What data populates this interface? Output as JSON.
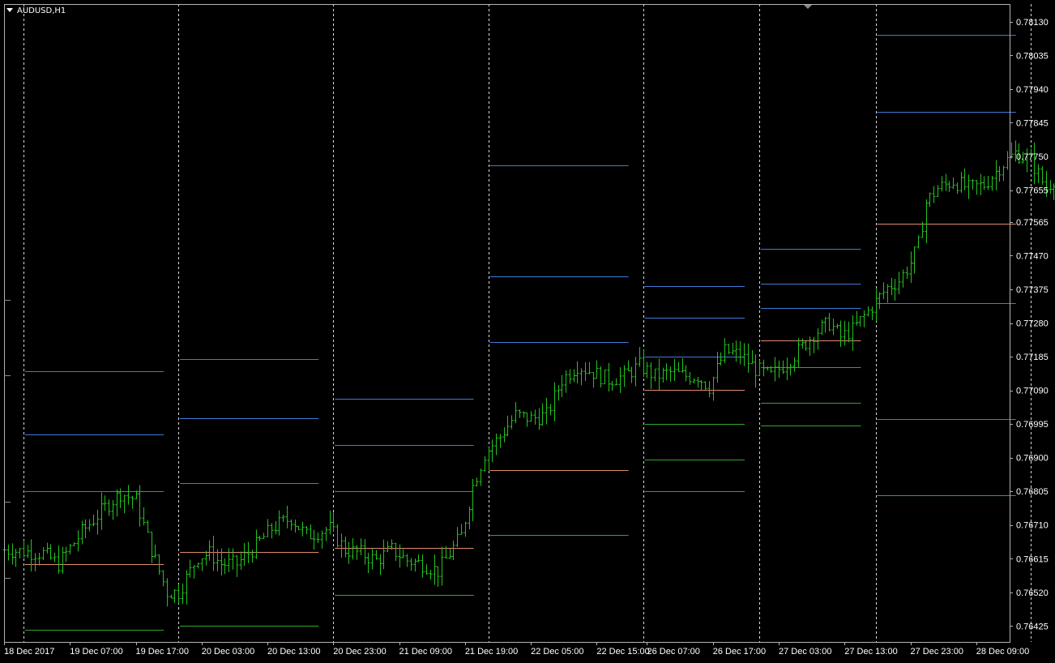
{
  "window": {
    "symbol_title": "AUDUSD,H1"
  },
  "chart_data": {
    "type": "ohlc",
    "symbol": "AUDUSD",
    "timeframe": "H1",
    "ylim": [
      0.7638,
      0.7818
    ],
    "y_ticks": [
      "0.78130",
      "0.78035",
      "0.77940",
      "0.77845",
      "0.77750",
      "0.77655",
      "0.77565",
      "0.77470",
      "0.77375",
      "0.77280",
      "0.77185",
      "0.77090",
      "0.76995",
      "0.76900",
      "0.76805",
      "0.76710",
      "0.76615",
      "0.76520",
      "0.76425"
    ],
    "x_tick_labels": [
      "18 Dec 2017",
      "19 Dec 07:00",
      "19 Dec 17:00",
      "20 Dec 03:00",
      "20 Dec 13:00",
      "20 Dec 23:00",
      "21 Dec 09:00",
      "21 Dec 19:00",
      "22 Dec 05:00",
      "22 Dec 15:00",
      "26 Dec 07:00",
      "26 Dec 17:00",
      "27 Dec 03:00",
      "27 Dec 13:00",
      "27 Dec 23:00",
      "28 Dec 09:00"
    ],
    "session_separators": [
      "18 Dec 2017",
      "19 Dec 2017",
      "20 Dec 2017",
      "21 Dec 2017",
      "22 Dec 2017",
      "26 Dec 2017",
      "27 Dec 2017",
      "28 Dec 2017"
    ],
    "close_path": [
      {
        "bar": 0,
        "price": 0.7664
      },
      {
        "bar": 10,
        "price": 0.7663
      },
      {
        "bar": 14,
        "price": 0.766
      },
      {
        "bar": 20,
        "price": 0.7669
      },
      {
        "bar": 26,
        "price": 0.7676
      },
      {
        "bar": 30,
        "price": 0.768
      },
      {
        "bar": 34,
        "price": 0.7678
      },
      {
        "bar": 38,
        "price": 0.7664
      },
      {
        "bar": 42,
        "price": 0.7652
      },
      {
        "bar": 45,
        "price": 0.7652
      },
      {
        "bar": 48,
        "price": 0.7658
      },
      {
        "bar": 50,
        "price": 0.7662
      },
      {
        "bar": 53,
        "price": 0.7663
      },
      {
        "bar": 56,
        "price": 0.766
      },
      {
        "bar": 60,
        "price": 0.766
      },
      {
        "bar": 64,
        "price": 0.7664
      },
      {
        "bar": 69,
        "price": 0.767
      },
      {
        "bar": 74,
        "price": 0.7673
      },
      {
        "bar": 78,
        "price": 0.7668
      },
      {
        "bar": 84,
        "price": 0.767
      },
      {
        "bar": 88,
        "price": 0.7664
      },
      {
        "bar": 92,
        "price": 0.7663
      },
      {
        "bar": 96,
        "price": 0.7661
      },
      {
        "bar": 100,
        "price": 0.7664
      },
      {
        "bar": 104,
        "price": 0.7661
      },
      {
        "bar": 108,
        "price": 0.766
      },
      {
        "bar": 112,
        "price": 0.7658
      },
      {
        "bar": 115,
        "price": 0.7663
      },
      {
        "bar": 118,
        "price": 0.7668
      },
      {
        "bar": 121,
        "price": 0.7682
      },
      {
        "bar": 124,
        "price": 0.7691
      },
      {
        "bar": 128,
        "price": 0.7696
      },
      {
        "bar": 132,
        "price": 0.7702
      },
      {
        "bar": 136,
        "price": 0.7701
      },
      {
        "bar": 140,
        "price": 0.7702
      },
      {
        "bar": 144,
        "price": 0.7712
      },
      {
        "bar": 148,
        "price": 0.7716
      },
      {
        "bar": 152,
        "price": 0.7714
      },
      {
        "bar": 156,
        "price": 0.7712
      },
      {
        "bar": 160,
        "price": 0.7713
      },
      {
        "bar": 164,
        "price": 0.7716
      },
      {
        "bar": 168,
        "price": 0.7713
      },
      {
        "bar": 172,
        "price": 0.7714
      },
      {
        "bar": 176,
        "price": 0.7713
      },
      {
        "bar": 179,
        "price": 0.7713
      },
      {
        "bar": 182,
        "price": 0.771
      },
      {
        "bar": 186,
        "price": 0.772
      },
      {
        "bar": 190,
        "price": 0.7719
      },
      {
        "bar": 194,
        "price": 0.7715
      },
      {
        "bar": 198,
        "price": 0.7713
      },
      {
        "bar": 201,
        "price": 0.7716
      },
      {
        "bar": 205,
        "price": 0.772
      },
      {
        "bar": 209,
        "price": 0.7725
      },
      {
        "bar": 213,
        "price": 0.7728
      },
      {
        "bar": 216,
        "price": 0.7724
      },
      {
        "bar": 219,
        "price": 0.7726
      },
      {
        "bar": 222,
        "price": 0.773
      },
      {
        "bar": 225,
        "price": 0.7734
      },
      {
        "bar": 228,
        "price": 0.7738
      },
      {
        "bar": 231,
        "price": 0.774
      },
      {
        "bar": 234,
        "price": 0.7745
      },
      {
        "bar": 236,
        "price": 0.775
      },
      {
        "bar": 238,
        "price": 0.7762
      },
      {
        "bar": 241,
        "price": 0.7766
      },
      {
        "bar": 245,
        "price": 0.7768
      },
      {
        "bar": 249,
        "price": 0.7766
      },
      {
        "bar": 253,
        "price": 0.7767
      },
      {
        "bar": 257,
        "price": 0.7772
      },
      {
        "bar": 261,
        "price": 0.7776
      },
      {
        "bar": 265,
        "price": 0.7774
      },
      {
        "bar": 269,
        "price": 0.7766
      },
      {
        "bar": 272,
        "price": 0.777
      },
      {
        "bar": 276,
        "price": 0.7777
      },
      {
        "bar": 280,
        "price": 0.7782
      },
      {
        "bar": 284,
        "price": 0.7786
      },
      {
        "bar": 288,
        "price": 0.7795
      },
      {
        "bar": 291,
        "price": 0.7802
      },
      {
        "bar": 294,
        "price": 0.7798
      },
      {
        "bar": 297,
        "price": 0.7788
      },
      {
        "bar": 299,
        "price": 0.7784
      },
      {
        "bar": 301,
        "price": 0.778
      }
    ],
    "pivot_levels": [
      {
        "session": 0,
        "levels": [
          {
            "kind": "resistance",
            "price": 0.77145
          },
          {
            "kind": "resistance",
            "price": 0.76965
          },
          {
            "kind": "resistance",
            "price": 0.76805
          },
          {
            "kind": "pivot",
            "price": 0.766
          },
          {
            "kind": "support",
            "price": 0.76415
          }
        ]
      },
      {
        "session": 1,
        "levels": [
          {
            "kind": "resistance",
            "price": 0.77178
          },
          {
            "kind": "resistance",
            "price": 0.77012
          },
          {
            "kind": "resistance",
            "price": 0.76828
          },
          {
            "kind": "pivot",
            "price": 0.76634
          },
          {
            "kind": "support",
            "price": 0.76425
          }
        ]
      },
      {
        "session": 2,
        "levels": [
          {
            "kind": "resistance",
            "price": 0.77066
          },
          {
            "kind": "resistance",
            "price": 0.76936
          },
          {
            "kind": "resistance",
            "price": 0.76805
          },
          {
            "kind": "pivot",
            "price": 0.76646
          },
          {
            "kind": "support",
            "price": 0.76512
          }
        ]
      },
      {
        "session": 3,
        "levels": [
          {
            "kind": "resistance",
            "price": 0.77724
          },
          {
            "kind": "resistance",
            "price": 0.77412
          },
          {
            "kind": "resistance",
            "price": 0.77226
          },
          {
            "kind": "pivot",
            "price": 0.76864
          },
          {
            "kind": "support",
            "price": 0.76682
          }
        ]
      },
      {
        "session": 4,
        "levels": [
          {
            "kind": "resistance",
            "price": 0.77385
          },
          {
            "kind": "resistance",
            "price": 0.77295
          },
          {
            "kind": "resistance",
            "price": 0.77185
          },
          {
            "kind": "pivot",
            "price": 0.77092
          },
          {
            "kind": "support",
            "price": 0.76995
          },
          {
            "kind": "support",
            "price": 0.76895
          },
          {
            "kind": "support",
            "price": 0.76805
          }
        ]
      },
      {
        "session": 5,
        "levels": [
          {
            "kind": "resistance",
            "price": 0.7749
          },
          {
            "kind": "resistance",
            "price": 0.77392
          },
          {
            "kind": "resistance",
            "price": 0.77322
          },
          {
            "kind": "pivot",
            "price": 0.7723
          },
          {
            "kind": "support",
            "price": 0.77155
          },
          {
            "kind": "support",
            "price": 0.77055
          },
          {
            "kind": "support",
            "price": 0.7699
          }
        ]
      },
      {
        "session": 6,
        "levels": [
          {
            "kind": "resistance",
            "price": 0.78092
          },
          {
            "kind": "resistance",
            "price": 0.77875
          },
          {
            "kind": "pivot",
            "price": 0.7756
          },
          {
            "kind": "support",
            "price": 0.77335
          },
          {
            "kind": "support",
            "price": 0.7701
          },
          {
            "kind": "support",
            "price": 0.76795
          }
        ]
      }
    ],
    "colors": {
      "background": "#000000",
      "bars": "#22c31d",
      "resistance": "#3d7bd9",
      "pivot": "#e08a6c",
      "support": "#2ea82a",
      "separator": "#d9d9d9",
      "axis_text": "#ffffff",
      "frame": "#b4b4b4"
    },
    "grid": false
  }
}
